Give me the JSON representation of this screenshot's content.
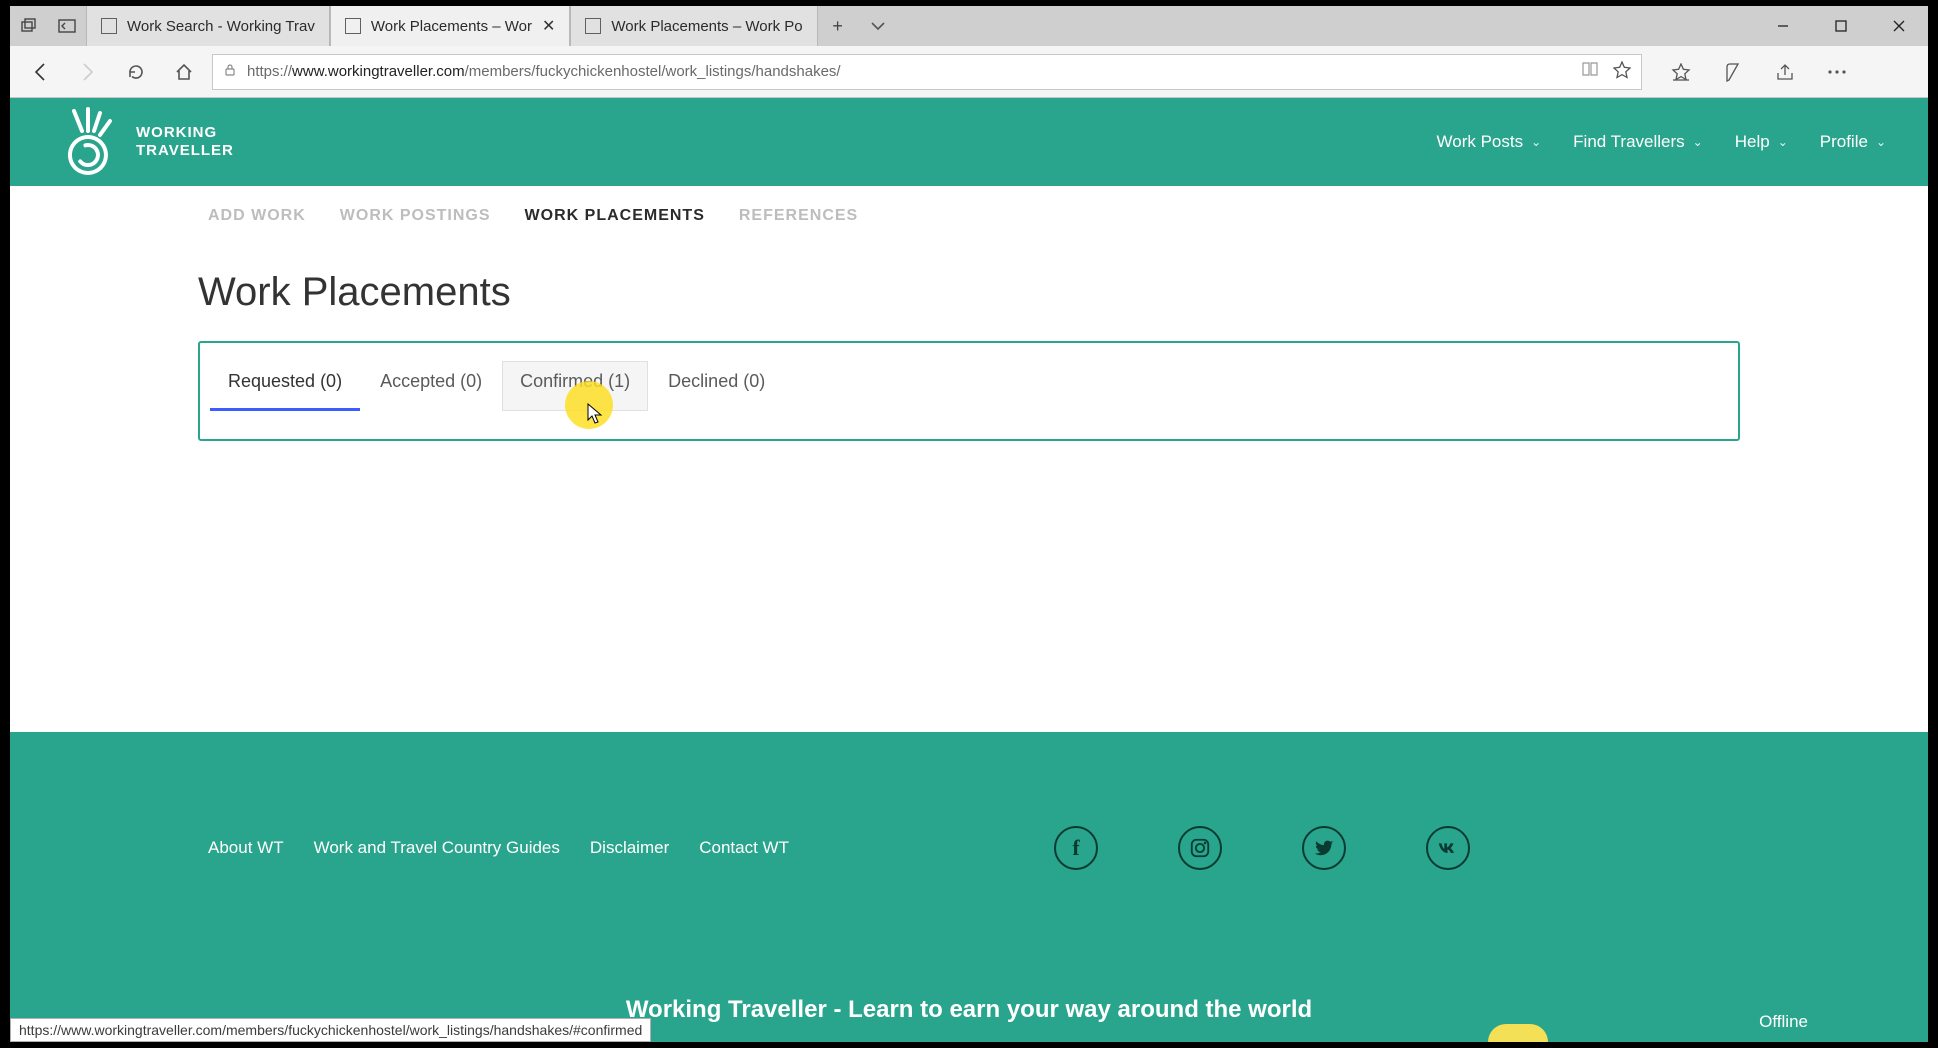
{
  "browser": {
    "tabs": [
      {
        "title": "Work Search - Working Trav",
        "active": false
      },
      {
        "title": "Work Placements – Wor",
        "active": true
      },
      {
        "title": "Work Placements – Work Po",
        "active": false
      }
    ],
    "url_prefix": "https://",
    "url_domain": "www.workingtraveller.com",
    "url_path": "/members/fuckychickenhostel/work_listings/handshakes/"
  },
  "header": {
    "brand_line1": "WORKING",
    "brand_line2": "TRAVELLER",
    "menu": [
      {
        "label": "Work Posts"
      },
      {
        "label": "Find Travellers"
      },
      {
        "label": "Help"
      },
      {
        "label": "Profile"
      }
    ]
  },
  "subnav": [
    {
      "label": "ADD WORK",
      "active": false
    },
    {
      "label": "WORK POSTINGS",
      "active": false
    },
    {
      "label": "WORK PLACEMENTS",
      "active": true
    },
    {
      "label": "REFERENCES",
      "active": false
    }
  ],
  "page": {
    "title": "Work Placements",
    "tabs": [
      {
        "label": "Requested (0)",
        "selected": true,
        "hover": false
      },
      {
        "label": "Accepted (0)",
        "selected": false,
        "hover": false
      },
      {
        "label": "Confirmed (1)",
        "selected": false,
        "hover": true
      },
      {
        "label": "Declined (0)",
        "selected": false,
        "hover": false
      }
    ]
  },
  "footer": {
    "links": [
      "About WT",
      "Work and Travel Country Guides",
      "Disclaimer",
      "Contact WT"
    ],
    "tagline": "Working Traveller - Learn to earn your way around the world",
    "status": "Offline"
  },
  "status_url": "https://www.workingtraveller.com/members/fuckychickenhostel/work_listings/handshakes/#confirmed"
}
